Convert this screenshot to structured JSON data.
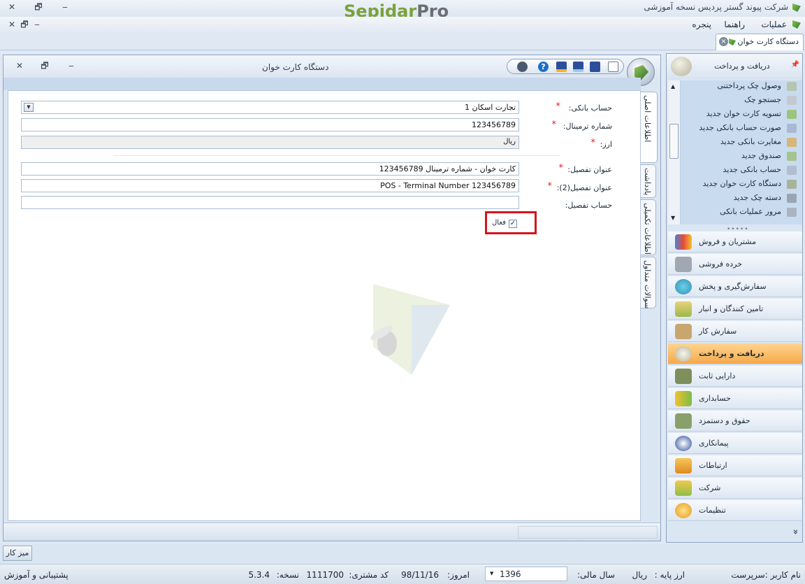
{
  "window": {
    "title": "شرکت پیوند گستر پردیس نسخه آموزشی",
    "brand_part1": "Sepidar",
    "brand_part2": "Pro",
    "controls": {
      "close": "✕",
      "restore": "🗗",
      "minimize": "‒"
    }
  },
  "menu": {
    "items": [
      "عملیات",
      "راهنما",
      "پنجره"
    ],
    "mdi_controls": {
      "close": "✕",
      "restore": "🗗",
      "minimize": "‒"
    }
  },
  "tab": {
    "label": "دستگاه کارت خوان",
    "close": "×"
  },
  "document": {
    "title": "دستگاه کارت خوان",
    "controls": {
      "close": "✕",
      "restore": "🗗",
      "minimize": "‒"
    },
    "vertical_tabs": [
      "اطلاعات اصلی",
      "یادداشت",
      "اطلاعات تکمیلی",
      "سوالات متداول"
    ],
    "fields": {
      "bank_account": {
        "label": "حساب بانکی:",
        "value": "تجارت اسکان 1",
        "required": "*"
      },
      "terminal_number": {
        "label": "شماره ترمینال:",
        "value": "123456789",
        "required": "*"
      },
      "currency": {
        "label": "ارز:",
        "value": "ریال",
        "required": "*"
      },
      "detail_title": {
        "label": "عنوان تفصیل:",
        "value": "کارت خوان - شماره ترمینال 123456789",
        "required": "*"
      },
      "detail_title2": {
        "label": "عنوان تفصیل(2):",
        "value": "POS - Terminal Number 123456789",
        "required": "*"
      },
      "detail_account": {
        "label": "حساب تفصیل:",
        "value": ""
      },
      "active": {
        "label": "فعال",
        "checked": true
      }
    }
  },
  "nav": {
    "header": "دریافت و پرداخت",
    "pin": "📌",
    "list_items": [
      "وصول چک پرداختنی",
      "جستجو چک",
      "تسویه کارت خوان جدید",
      "صورت حساب بانکی جدید",
      "مغایرت بانکی جدید",
      "صندوق جدید",
      "حساب بانکی جدید",
      "دستگاه کارت خوان جدید",
      "دسته چک جدید",
      "مرور عملیات بانکی"
    ],
    "modules": [
      "مشتریان و فروش",
      "خرده فروشی",
      "سفارش‌گیری و پخش",
      "تامین کنندگان و انبار",
      "سفارش کار",
      "دریافت و پرداخت",
      "دارایی ثابت",
      "حسابداری",
      "حقوق و دستمزد",
      "پیمانکاری",
      "ارتباطات",
      "شرکت",
      "تنظیمات"
    ],
    "active_module": "دریافت و پرداخت",
    "expand": "»"
  },
  "taskbar": {
    "desktop": "میز کار"
  },
  "status": {
    "user": "نام کاربر :سرپرست",
    "base_currency_label": "ارز پایه :",
    "base_currency": "ریال",
    "fiscal_year_label": "سال مالی:",
    "fiscal_year": "1396",
    "today_label": "امروز:",
    "today": "98/11/16",
    "customer_code_label": "کد مشتری:",
    "customer_code": "1111700",
    "version_label": "نسخه:",
    "version": "5.3.4",
    "support": "پشتیبانی و آموزش"
  },
  "colors": {
    "accent": "#f6a94a",
    "required": "#e0212e",
    "highlight_box": "#d3151f",
    "brand_green": "#7aa23a"
  }
}
